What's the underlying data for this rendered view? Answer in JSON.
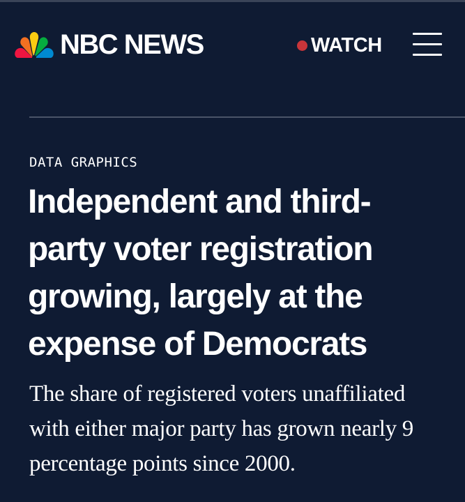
{
  "header": {
    "logo_text": "NBC NEWS",
    "watch_label": "WATCH",
    "watch_dot_color": "#c8353a",
    "menu_icon": "hamburger-menu-icon"
  },
  "article": {
    "eyebrow": "DATA GRAPHICS",
    "headline": "Independent and third-party voter registration growing, largely at the expense of Democrats",
    "dek": "The share of registered voters unaffiliated with either major party has grown nearly 9 percentage points since 2000."
  },
  "colors": {
    "background": "#0f1b33",
    "text": "#ffffff",
    "divider": "#4a5468",
    "peacock": [
      "#fccc12",
      "#ef1541",
      "#6460aa",
      "#0089d0",
      "#05ac3f",
      "#f37021"
    ]
  }
}
